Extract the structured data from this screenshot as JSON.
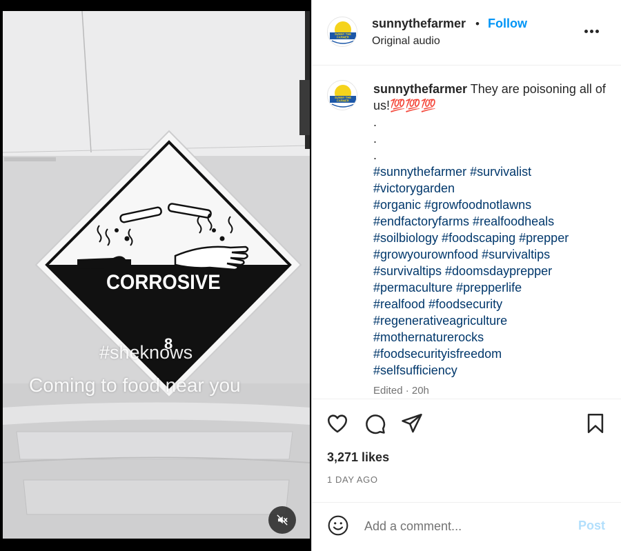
{
  "video": {
    "sign_label": "CORROSIVE",
    "sign_number": "8",
    "overlay_hashtag": "#sheknows",
    "overlay_caption": "Coming to food near you",
    "mute_icon": "muted-speaker-icon"
  },
  "header": {
    "username": "sunnythefarmer",
    "separator": "•",
    "follow_label": "Follow",
    "audio_label": "Original audio",
    "more_icon": "more-options-icon"
  },
  "avatar": {
    "logo_text": "SUNNY THE FARMER",
    "sun_color": "#f5d31c",
    "ring_color": "#1b57a8"
  },
  "caption": {
    "username": "sunnythefarmer",
    "text": "They are poisoning all of us!💯💯💯",
    "dots": [
      ".",
      ".",
      "."
    ],
    "hashtag_lines": [
      "#sunnythefarmer #survivalist",
      "#victorygarden",
      "#organic #growfoodnotlawns",
      "#endfactoryfarms #realfoodheals",
      "#soilbiology #foodscaping #prepper",
      "#growyourownfood #survivaltips",
      "#survivaltips #doomsdayprepper",
      "#permaculture #prepperlife",
      "#realfood #foodsecurity",
      "#regenerativeagriculture",
      "#mothernaturerocks",
      "#foodsecurityisfreedom",
      "#selfsufficiency"
    ],
    "edited_label": "Edited · 20h"
  },
  "actions": {
    "like_icon": "heart-icon",
    "comment_icon": "comment-icon",
    "share_icon": "share-icon",
    "save_icon": "bookmark-icon",
    "likes_text": "3,271 likes",
    "time_text": "1 DAY AGO"
  },
  "comment": {
    "emoji_icon": "emoji-icon",
    "placeholder": "Add a comment...",
    "post_label": "Post"
  },
  "colors": {
    "accent": "#0095f6",
    "hashtag": "#00376b",
    "post_disabled": "#b2dffc"
  }
}
